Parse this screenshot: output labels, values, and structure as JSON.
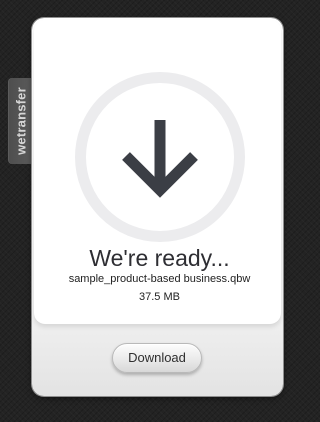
{
  "brand": {
    "tab_label": "wetransfer"
  },
  "download_panel": {
    "icon": "arrow-down-icon",
    "title": "We're ready...",
    "file_name": "sample_product-based business.qbw",
    "file_size": "37.5 MB",
    "button_label": "Download"
  },
  "colors": {
    "background": "#232323",
    "icon": "#3b3e45",
    "ring": "#ececee"
  }
}
